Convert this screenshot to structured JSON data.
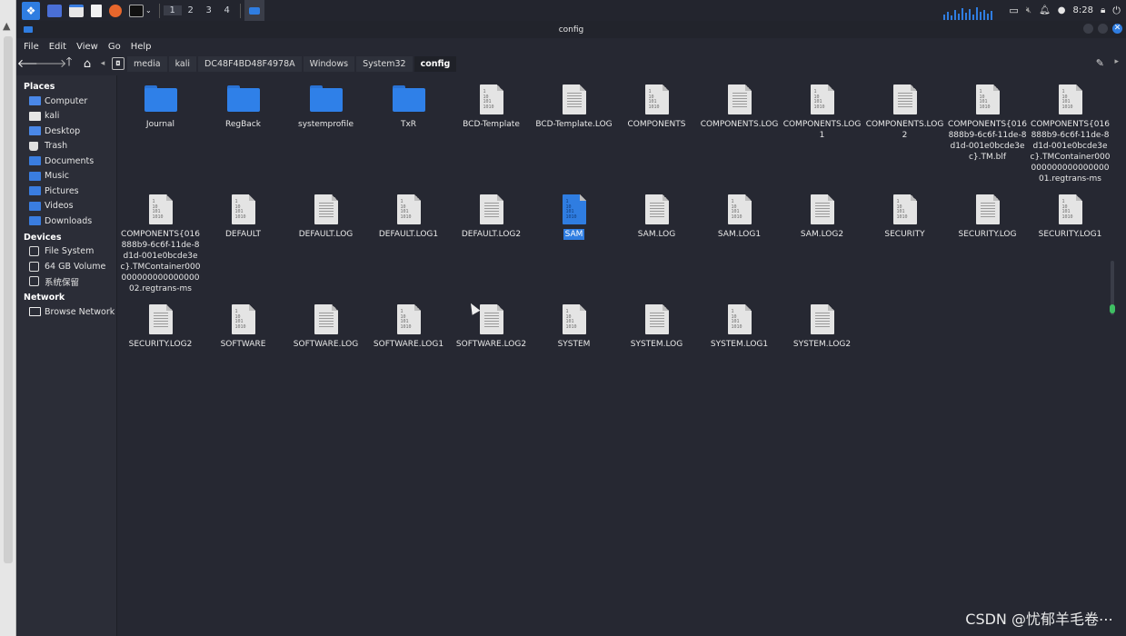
{
  "panel": {
    "workspaces": [
      "1",
      "2",
      "3",
      "4"
    ],
    "clock": "8:28"
  },
  "window": {
    "title": "config"
  },
  "menu": [
    "File",
    "Edit",
    "View",
    "Go",
    "Help"
  ],
  "breadcrumbs": [
    "media",
    "kali",
    "DC48F4BD48F4978A",
    "Windows",
    "System32",
    "config"
  ],
  "sidebar": {
    "places_label": "Places",
    "places": [
      {
        "label": "Computer",
        "icon": "computer-icon"
      },
      {
        "label": "kali",
        "icon": "home-folder-icon"
      },
      {
        "label": "Desktop",
        "icon": "desktop-icon"
      },
      {
        "label": "Trash",
        "icon": "trash-icon"
      },
      {
        "label": "Documents",
        "icon": "folder-icon"
      },
      {
        "label": "Music",
        "icon": "folder-icon"
      },
      {
        "label": "Pictures",
        "icon": "folder-icon"
      },
      {
        "label": "Videos",
        "icon": "folder-icon"
      },
      {
        "label": "Downloads",
        "icon": "folder-icon"
      }
    ],
    "devices_label": "Devices",
    "devices": [
      {
        "label": "File System",
        "icon": "drive-icon"
      },
      {
        "label": "64 GB Volume",
        "icon": "drive-icon"
      },
      {
        "label": "系统保留",
        "icon": "drive-icon"
      }
    ],
    "network_label": "Network",
    "network": [
      {
        "label": "Browse Network",
        "icon": "network-icon"
      }
    ]
  },
  "files": [
    {
      "name": "Journal",
      "type": "folder"
    },
    {
      "name": "RegBack",
      "type": "folder"
    },
    {
      "name": "systemprofile",
      "type": "folder"
    },
    {
      "name": "TxR",
      "type": "folder"
    },
    {
      "name": "BCD-Template",
      "type": "binary"
    },
    {
      "name": "BCD-Template.LOG",
      "type": "text"
    },
    {
      "name": "COMPONENTS",
      "type": "binary"
    },
    {
      "name": "COMPONENTS.LOG",
      "type": "text"
    },
    {
      "name": "COMPONENTS.LOG1",
      "type": "binary"
    },
    {
      "name": "COMPONENTS.LOG2",
      "type": "text"
    },
    {
      "name": "COMPONENTS{016888b9-6c6f-11de-8d1d-001e0bcde3ec}.TM.blf",
      "type": "binary"
    },
    {
      "name": "COMPONENTS{016888b9-6c6f-11de-8d1d-001e0bcde3ec}.TMContainer00000000000000000001.regtrans-ms",
      "type": "binary"
    },
    {
      "name": "COMPONENTS{016888b9-6c6f-11de-8d1d-001e0bcde3ec}.TMContainer00000000000000000002.regtrans-ms",
      "type": "binary"
    },
    {
      "name": "DEFAULT",
      "type": "binary"
    },
    {
      "name": "DEFAULT.LOG",
      "type": "text"
    },
    {
      "name": "DEFAULT.LOG1",
      "type": "binary"
    },
    {
      "name": "DEFAULT.LOG2",
      "type": "text"
    },
    {
      "name": "SAM",
      "type": "binary",
      "selected": true
    },
    {
      "name": "SAM.LOG",
      "type": "text"
    },
    {
      "name": "SAM.LOG1",
      "type": "binary"
    },
    {
      "name": "SAM.LOG2",
      "type": "text"
    },
    {
      "name": "SECURITY",
      "type": "binary"
    },
    {
      "name": "SECURITY.LOG",
      "type": "text"
    },
    {
      "name": "SECURITY.LOG1",
      "type": "binary"
    },
    {
      "name": "SECURITY.LOG2",
      "type": "text"
    },
    {
      "name": "SOFTWARE",
      "type": "binary"
    },
    {
      "name": "SOFTWARE.LOG",
      "type": "text"
    },
    {
      "name": "SOFTWARE.LOG1",
      "type": "binary"
    },
    {
      "name": "SOFTWARE.LOG2",
      "type": "text"
    },
    {
      "name": "SYSTEM",
      "type": "binary"
    },
    {
      "name": "SYSTEM.LOG",
      "type": "text"
    },
    {
      "name": "SYSTEM.LOG1",
      "type": "binary"
    },
    {
      "name": "SYSTEM.LOG2",
      "type": "text"
    }
  ],
  "watermark": "CSDN @忧郁羊毛卷⋯",
  "colors": {
    "accent": "#2f7de1",
    "background": "#262832",
    "sidebar": "#2b2d37"
  }
}
